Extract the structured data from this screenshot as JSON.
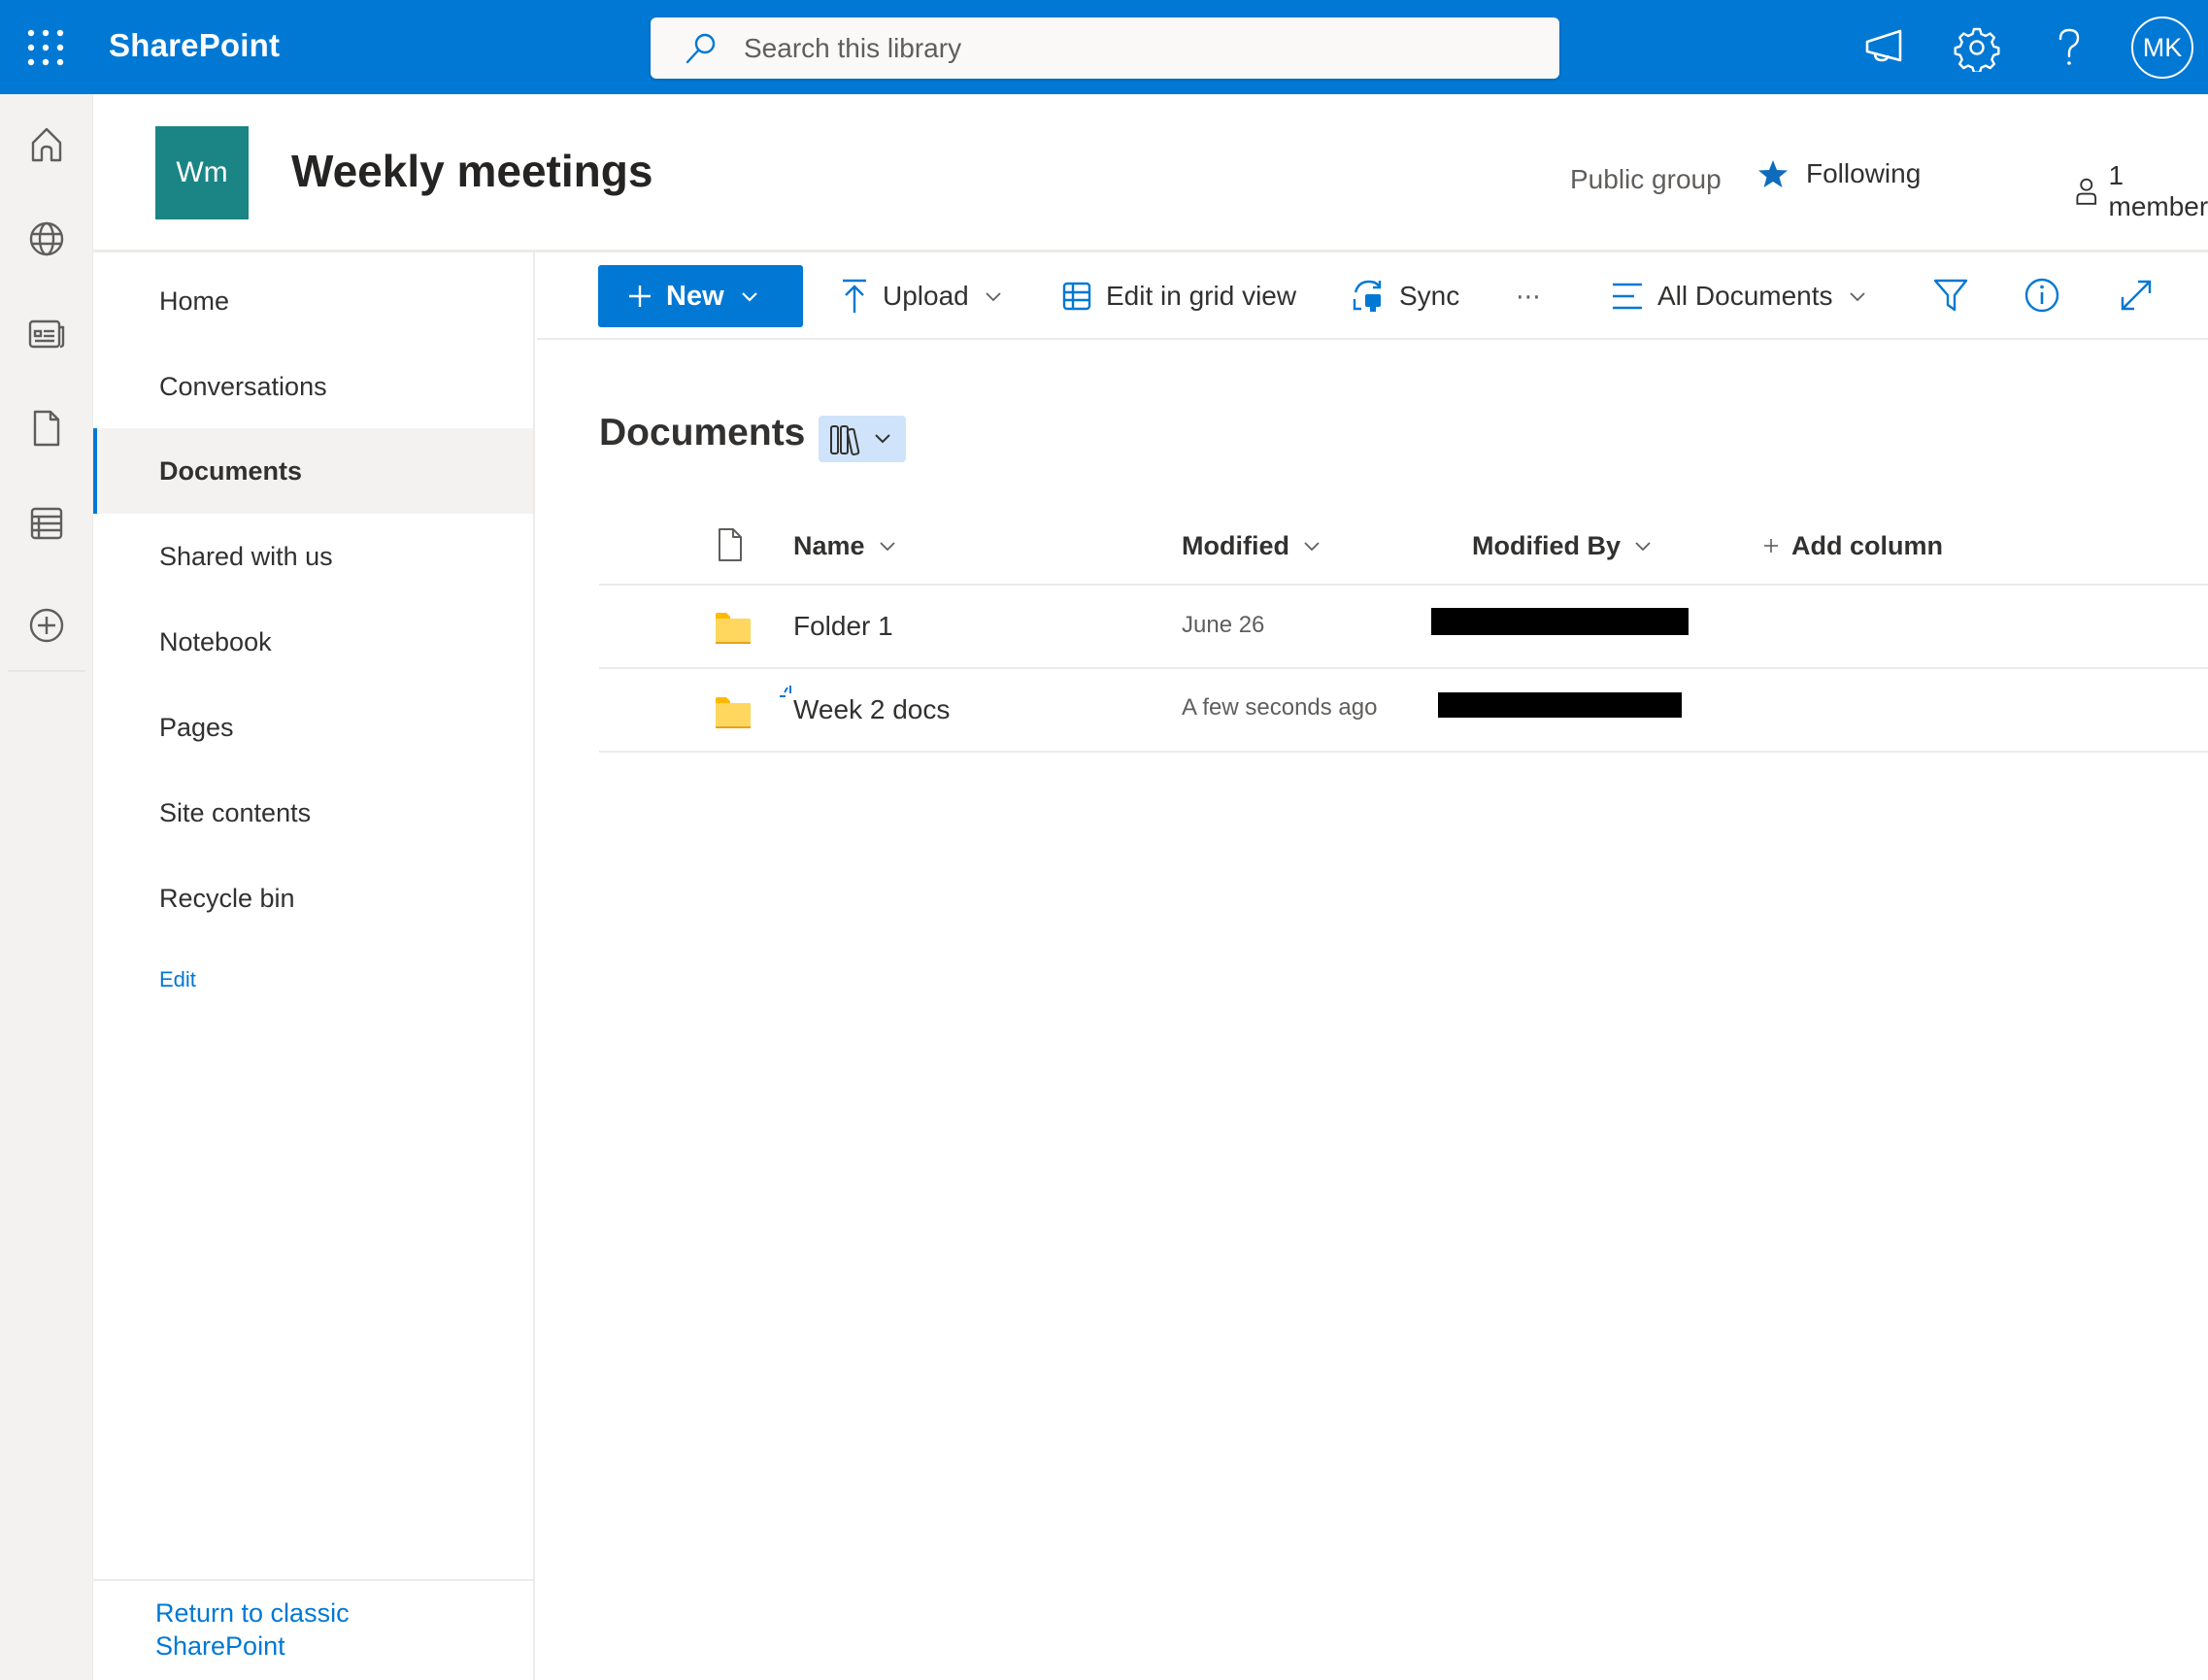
{
  "suitebar": {
    "app_name": "SharePoint",
    "search_placeholder": "Search this library",
    "icons": [
      "app-launcher-icon",
      "megaphone-icon",
      "settings-gear-icon",
      "help-question-icon"
    ],
    "avatar_initials": "MK",
    "color": "#0078d4"
  },
  "rail": {
    "icons": [
      "home-icon",
      "globe-icon",
      "news-icon",
      "file-icon",
      "list-icon",
      "add-circle-icon"
    ]
  },
  "site": {
    "logo_initials": "Wm",
    "logo_color": "#1a8584",
    "title": "Weekly meetings",
    "privacy": "Public group",
    "follow_label": "Following",
    "members_label": "1 member"
  },
  "nav": {
    "items": [
      {
        "label": "Home",
        "active": false
      },
      {
        "label": "Conversations",
        "active": false
      },
      {
        "label": "Documents",
        "active": true
      },
      {
        "label": "Shared with us",
        "active": false
      },
      {
        "label": "Notebook",
        "active": false
      },
      {
        "label": "Pages",
        "active": false
      },
      {
        "label": "Site contents",
        "active": false
      },
      {
        "label": "Recycle bin",
        "active": false
      }
    ],
    "edit_label": "Edit",
    "classic_link": "Return to classic SharePoint"
  },
  "commandbar": {
    "new_label": "New",
    "upload_label": "Upload",
    "grid_label": "Edit in grid view",
    "sync_label": "Sync",
    "more_label": "⋯",
    "view_label": "All Documents"
  },
  "library": {
    "title": "Documents",
    "columns": {
      "name": "Name",
      "modified": "Modified",
      "modified_by": "Modified By",
      "add_column": "Add column"
    },
    "rows": [
      {
        "name": "Folder 1",
        "modified": "June 26",
        "modified_by": "[redacted]",
        "new": false
      },
      {
        "name": "Week 2 docs",
        "modified": "A few seconds ago",
        "modified_by": "[redacted]",
        "new": true
      }
    ]
  }
}
